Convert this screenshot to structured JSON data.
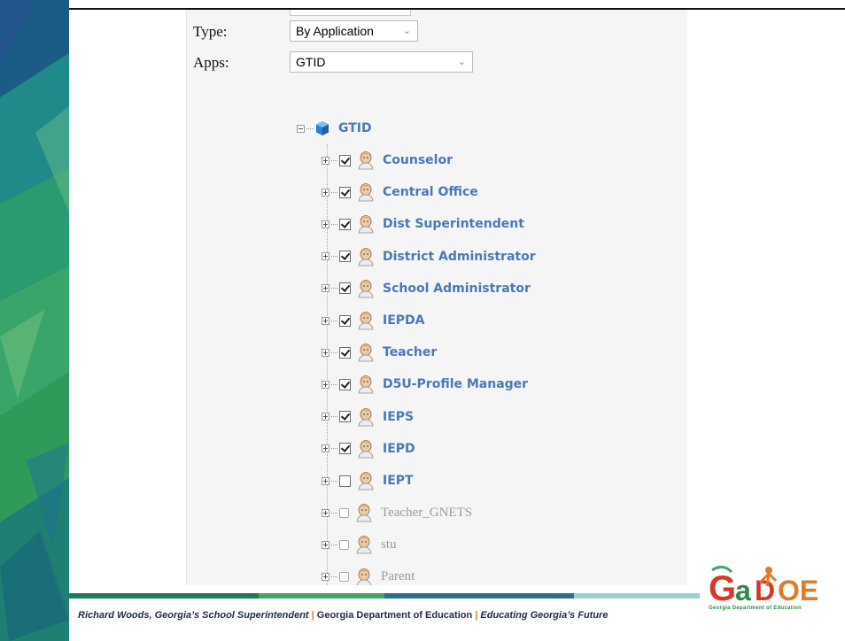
{
  "form": {
    "type_label": "Type:",
    "type_value": "By Application",
    "apps_label": "Apps:",
    "apps_value": "GTID"
  },
  "tree": {
    "root_label": "GTID",
    "roles": [
      {
        "label": "Counselor",
        "checked": true,
        "enabled": true
      },
      {
        "label": "Central Office",
        "checked": true,
        "enabled": true
      },
      {
        "label": "Dist Superintendent",
        "checked": true,
        "enabled": true
      },
      {
        "label": "District Administrator",
        "checked": true,
        "enabled": true
      },
      {
        "label": "School Administrator",
        "checked": true,
        "enabled": true
      },
      {
        "label": "IEPDA",
        "checked": true,
        "enabled": true
      },
      {
        "label": "Teacher",
        "checked": true,
        "enabled": true
      },
      {
        "label": "D5U-Profile Manager",
        "checked": true,
        "enabled": true
      },
      {
        "label": "IEPS",
        "checked": true,
        "enabled": true
      },
      {
        "label": "IEPD",
        "checked": true,
        "enabled": true
      },
      {
        "label": "IEPT",
        "checked": false,
        "enabled": true
      },
      {
        "label": "Teacher_GNETS",
        "checked": false,
        "enabled": false
      },
      {
        "label": "stu",
        "checked": false,
        "enabled": false
      },
      {
        "label": "Parent",
        "checked": false,
        "enabled": false
      }
    ]
  },
  "footer": {
    "part1": "Richard Woods, Georgia’s School Superintendent",
    "sep": "|",
    "part2": "Georgia Department of Education",
    "part3": "Educating Georgia’s Future",
    "logo_text": "GaDOE",
    "logo_subtext": "Georgia Department of Education"
  },
  "colors": {
    "link_blue": "#4a79b5",
    "disabled_gray": "#9a9a9a",
    "footer_navy": "#1f2a44",
    "accent_orange": "#e07b2b",
    "brand_green": "#2a8d4a",
    "brand_red": "#d9362b"
  }
}
